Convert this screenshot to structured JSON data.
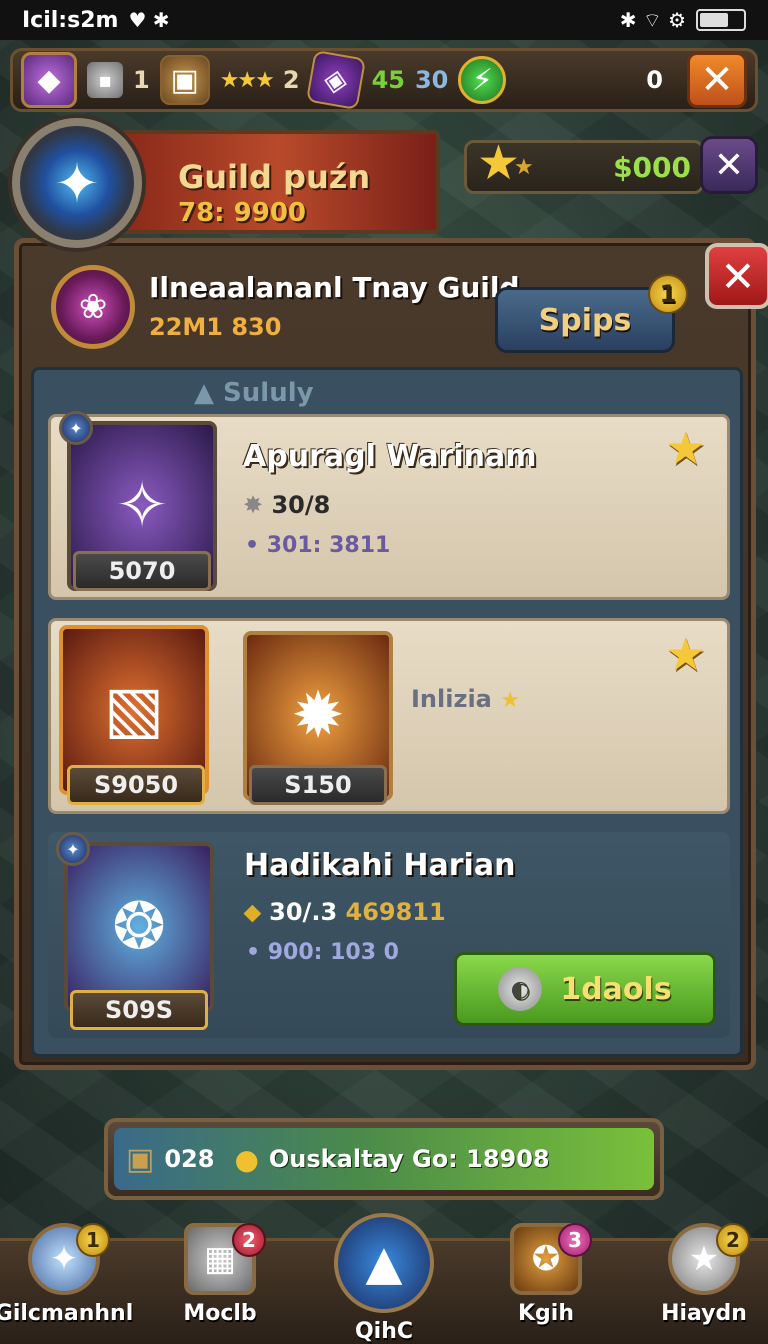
{
  "status_bar": {
    "time": "Icil:s2m",
    "left_icons": "♥ ✱",
    "right_icons": "✱ ⌔ ⚙"
  },
  "resource_bar": {
    "count_1": "1",
    "stars": "★★★",
    "count_2": "2",
    "green_value": "45",
    "blue_value": "30",
    "zero_value": "0",
    "close_glyph": "✕"
  },
  "guild_banner": {
    "title": "Guild puźn",
    "subtitle": "78: 9900"
  },
  "gold_display": {
    "value": "$000",
    "close_glyph": "✕"
  },
  "panel": {
    "guild_name": "Ilneaalananl Tnay Guild",
    "guild_code": "22M1 830",
    "spips_label": "Spips",
    "spips_badge": "1",
    "close_glyph": "✕",
    "list_heading": "▲ Sululy"
  },
  "cards": [
    {
      "title": "Apuragl Warinam",
      "stat": "30/8",
      "sub": "• 301: 3811",
      "price": "5070"
    },
    {
      "price_1": "S9050",
      "price_2": "S150",
      "label": "Inlizia"
    },
    {
      "title": "Hadikahi Harian",
      "stat": "30/.3",
      "stat_extra": "469811",
      "sub": "• 900: 103 0",
      "price": "S09S",
      "button_label": "1daols"
    }
  ],
  "summary": {
    "count": "028",
    "text": "Ouskaltay Go: 18908"
  },
  "bottom_nav": [
    {
      "label": "Gilcmanhnl",
      "badge": "1"
    },
    {
      "label": "Moclb",
      "badge": "2"
    },
    {
      "label": "QihC",
      "badge": ""
    },
    {
      "label": "Kgih",
      "badge": "3"
    },
    {
      "label": "Hiaydn",
      "badge": "2"
    }
  ],
  "colors": {
    "accent_gold": "#f5c83a",
    "green_button": "#6ac030",
    "close_red": "#d03030",
    "close_orange": "#e07020"
  }
}
